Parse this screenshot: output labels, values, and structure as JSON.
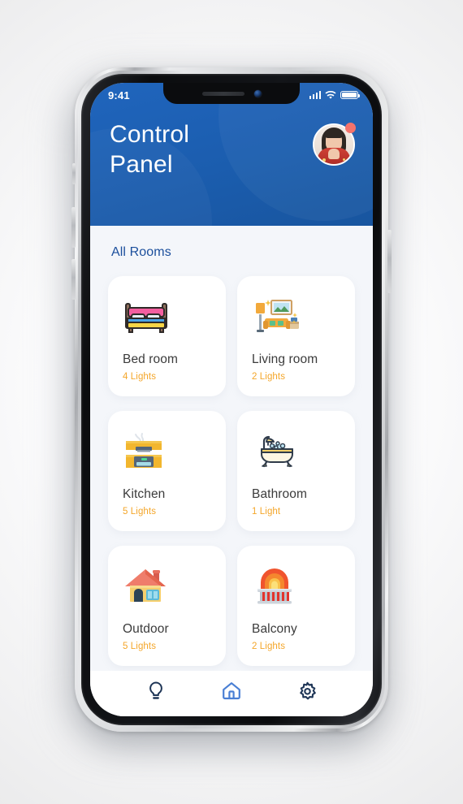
{
  "statusbar": {
    "time": "9:41",
    "signal_icon": "signal-bars-icon",
    "wifi_icon": "wifi-icon",
    "battery_icon": "battery-icon"
  },
  "header": {
    "title": "Control Panel",
    "title_line1": "Control",
    "title_line2": "Panel",
    "background_color": "#1a5fb4",
    "avatar_name": "user-avatar",
    "avatar_badge": true
  },
  "panel": {
    "section_title": "All Rooms",
    "background_color": "#f4f6fa"
  },
  "rooms": [
    {
      "name": "Bed room",
      "lights": "4 Lights",
      "icon": "bed-icon"
    },
    {
      "name": "Living room",
      "lights": "2 Lights",
      "icon": "sofa-icon"
    },
    {
      "name": "Kitchen",
      "lights": "5 Lights",
      "icon": "kitchen-icon"
    },
    {
      "name": "Bathroom",
      "lights": "1 Light",
      "icon": "bathtub-icon"
    },
    {
      "name": "Outdoor",
      "lights": "5 Lights",
      "icon": "house-icon"
    },
    {
      "name": "Balcony",
      "lights": "2 Lights",
      "icon": "balcony-icon"
    }
  ],
  "bottom_nav": {
    "items": [
      {
        "icon": "lightbulb-icon",
        "label": "Lights",
        "active": false
      },
      {
        "icon": "home-icon",
        "label": "Home",
        "active": true
      },
      {
        "icon": "gear-icon",
        "label": "Settings",
        "active": false
      }
    ],
    "active_color": "#4a7fd4",
    "inactive_color": "#1e3556"
  },
  "accent_colors": {
    "brand_blue": "#1a5fb4",
    "title_blue": "#1c4f9c",
    "lights_orange": "#f4a62a",
    "room_name_gray": "#3b3b3b",
    "badge_red": "#f4736b"
  }
}
